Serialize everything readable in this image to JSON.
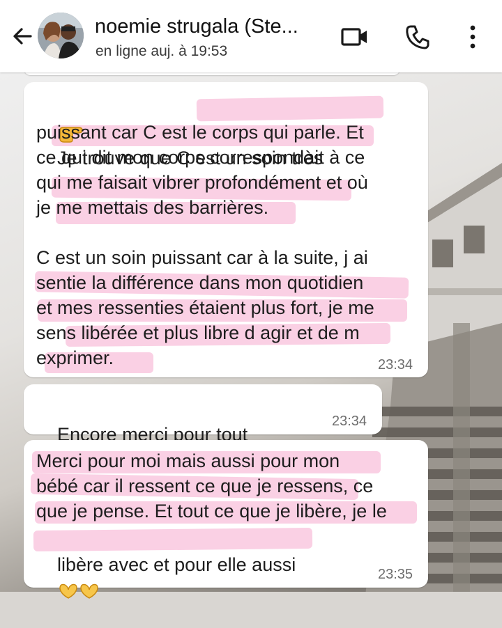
{
  "header": {
    "contact_name": "noemie strugala (Ste...",
    "status": "en ligne auj. à 19:53"
  },
  "messages": [
    {
      "lines": [
        "Je trouve que C est un soin très",
        "puissant car C est le corps qui parle. Et",
        "ce qui dit mon corps correspondait à ce",
        "qui me faisait vibrer profondément et où",
        "je me mettais des barrières.",
        "",
        "C est un soin puissant car à la suite, j ai",
        "sentie la différence dans mon quotidien",
        "et mes ressenties étaient plus fort, je me",
        "sens libérée et plus libre d agir et de m",
        "exprimer."
      ],
      "time": "23:34",
      "leading_emoji": "pointing-right-emoji"
    },
    {
      "text": "Encore merci pour tout",
      "time": "23:34",
      "trailing_emoji": "heart-hands-emoji"
    },
    {
      "lines": [
        "Merci pour moi mais aussi pour mon",
        "bébé car il ressent ce que je ressens, ce",
        "que je pense. Et tout ce que je libère, je le",
        "libère avec et pour elle aussi"
      ],
      "time": "23:35",
      "trailing_emoji": "heart-hands-emoji"
    }
  ],
  "colors": {
    "highlight": "#f6aacd",
    "bubble": "#ffffff",
    "header": "#ffffff"
  }
}
